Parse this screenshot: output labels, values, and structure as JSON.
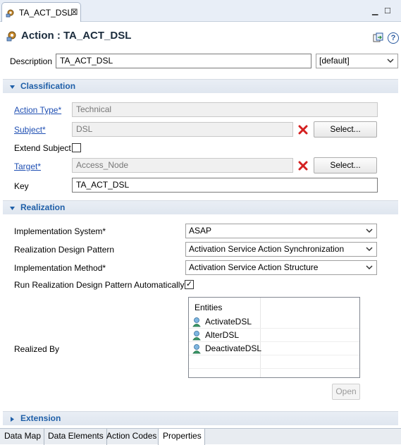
{
  "editor_tab": {
    "label": "TA_ACT_DSL",
    "close_glyph": "⊠"
  },
  "window_controls": {
    "minimize": "▁",
    "maximize": "☐"
  },
  "header": {
    "title": "Action : TA_ACT_DSL",
    "help_glyph": "?"
  },
  "description": {
    "label": "Description",
    "value": "TA_ACT_DSL",
    "locale_value": "[default]"
  },
  "classification": {
    "title": "Classification",
    "action_type": {
      "label": "Action Type*",
      "value": "Technical"
    },
    "subject": {
      "label": "Subject*",
      "value": "DSL",
      "select_label": "Select..."
    },
    "extend_subject": {
      "label": "Extend Subject",
      "checked": false
    },
    "target": {
      "label": "Target*",
      "value": "Access_Node",
      "select_label": "Select..."
    },
    "key": {
      "label": "Key",
      "value": "TA_ACT_DSL"
    }
  },
  "realization": {
    "title": "Realization",
    "implementation_system": {
      "label": "Implementation System*",
      "value": "ASAP"
    },
    "design_pattern": {
      "label": "Realization Design Pattern",
      "value": "Activation Service Action Synchronization"
    },
    "implementation_method": {
      "label": "Implementation Method*",
      "value": "Activation Service Action Structure"
    },
    "run_automatically": {
      "label": "Run Realization Design Pattern Automatically",
      "checked": true,
      "check_glyph": "✓"
    },
    "realized_by": {
      "label": "Realized By",
      "column_header": "Entities",
      "items": [
        "ActivateDSL",
        "AlterDSL",
        "DeactivateDSL"
      ],
      "open_label": "Open"
    }
  },
  "extension": {
    "title": "Extension"
  },
  "bottom_tabs": [
    "Data Map",
    "Data Elements",
    "Action Codes",
    "Properties"
  ],
  "colors": {
    "link": "#1f4fb3",
    "section_title": "#1f5fa8",
    "clear_x": "#d42020",
    "entity_icon": "#3a9a6a"
  },
  "icons": {
    "editor_tab": "action-icon",
    "title": "action-icon",
    "compare": "compare-icon",
    "help": "help-icon",
    "clear": "clear-x-icon",
    "entity": "entity-icon",
    "expanded": "triangle-down-icon",
    "collapsed": "triangle-right-icon",
    "dropdown": "chevron-down-icon"
  }
}
